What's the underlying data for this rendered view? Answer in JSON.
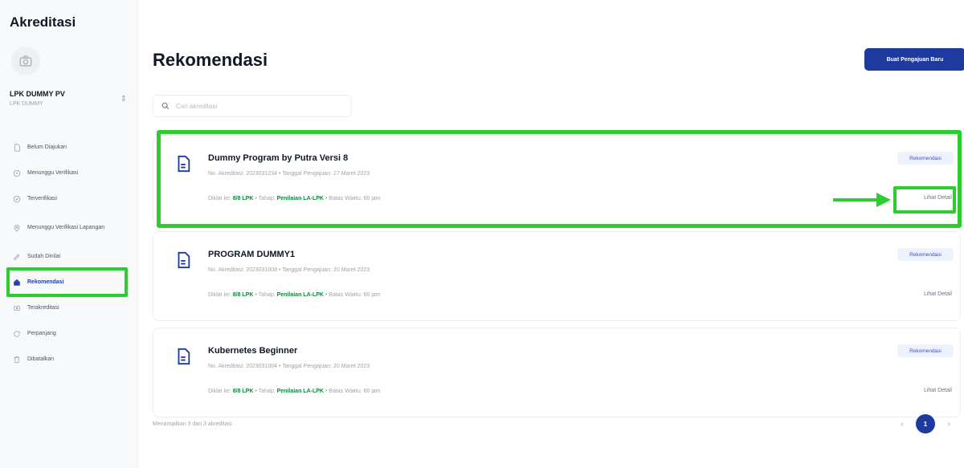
{
  "app": {
    "title": "Akreditasi"
  },
  "org": {
    "name": "LPK DUMMY PV",
    "sub": "LPK DUMMY"
  },
  "sidebar": {
    "items": [
      {
        "label": "Belum Diajukan",
        "icon": "file-icon"
      },
      {
        "label": "Menunggu Verifikasi",
        "icon": "clock-icon"
      },
      {
        "label": "Terverifikasi",
        "icon": "check-circle-icon"
      },
      {
        "label": "Menunggu Verifikasi Lapangan",
        "icon": "map-pin-icon"
      },
      {
        "label": "Sudah Dinilai",
        "icon": "pencil-icon"
      },
      {
        "label": "Rekomendasi",
        "icon": "award-icon",
        "active": true
      },
      {
        "label": "Terakreditasi",
        "icon": "badge-icon"
      },
      {
        "label": "Perpanjang",
        "icon": "refresh-icon"
      },
      {
        "label": "Dibatalkan",
        "icon": "trash-icon"
      }
    ]
  },
  "header": {
    "title": "Rekomendasi",
    "primary_button": "Buat Pengajuan Baru"
  },
  "search": {
    "placeholder": "Cari akreditasi"
  },
  "cards": [
    {
      "title": "Dummy Program by Putra Versi 8",
      "meta": "No. Akreditasi: 2023031234 • Tanggal Pengajuan: 27 Maret 2023",
      "meta2_prefix": "Diklat ke: ",
      "meta2_a": "8/8 LPK",
      "meta2_mid": " • Tahap: ",
      "meta2_b": "Penilaian LA-LPK",
      "meta2_end": " • Batas Waktu: 60 jam",
      "badge": "Rekomendasi",
      "link": "Lihat Detail"
    },
    {
      "title": "PROGRAM DUMMY1",
      "meta": "No. Akreditasi: 2023031008 • Tanggal Pengajuan: 20 Maret 2023",
      "meta2_prefix": "Diklat ke: ",
      "meta2_a": "8/8 LPK",
      "meta2_mid": " • Tahap: ",
      "meta2_b": "Penilaian LA-LPK",
      "meta2_end": " • Batas Waktu: 60 jam",
      "badge": "Rekomendasi",
      "link": "Lihat Detail"
    },
    {
      "title": "Kubernetes Beginner",
      "meta": "No. Akreditasi: 2023031004 • Tanggal Pengajuan: 20 Maret 2023",
      "meta2_prefix": "Diklat ke: ",
      "meta2_a": "8/8 LPK",
      "meta2_mid": " • Tahap: ",
      "meta2_b": "Penilaian LA-LPK",
      "meta2_end": " • Batas Waktu: 60 jam",
      "badge": "Rekomendasi",
      "link": "Lihat Detail"
    }
  ],
  "footer": {
    "info": "Menampilkan 3 dari 3 akreditasi"
  },
  "pagination": {
    "prev": "‹",
    "current": "1",
    "next": "›"
  },
  "colors": {
    "accent": "#1e3a9e",
    "highlight": "#2ecc2e",
    "active_nav": "#1e40af"
  }
}
